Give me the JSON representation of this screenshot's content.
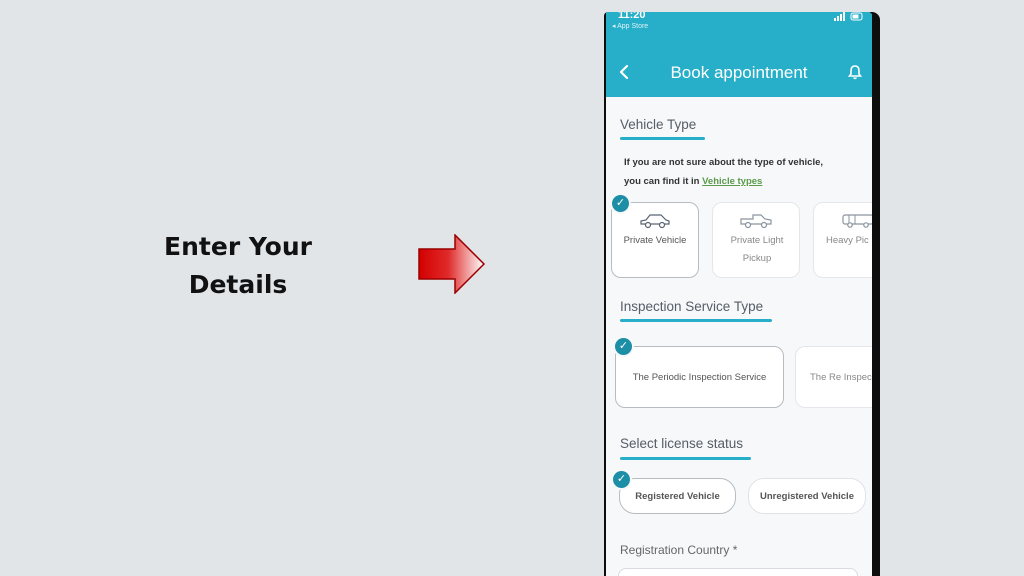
{
  "caption": {
    "line1": "Enter Your",
    "line2": "Details"
  },
  "colors": {
    "accent": "#27aec8",
    "check": "#1c8ea6",
    "arrow": "#d40000",
    "link": "#5a9a4a"
  },
  "status_bar": {
    "time": "11:20",
    "back_to": "◂ App Store",
    "icons": "📶 ◔ ▭"
  },
  "header": {
    "title": "Book appointment",
    "back_icon": "chevron-left-icon",
    "bell_icon": "bell-icon"
  },
  "vehicle_type": {
    "title": "Vehicle Type",
    "hint_line1": "If you are not sure about the type of vehicle,",
    "hint_line2": "you can find it in",
    "hint_link": "Vehicle types",
    "options": [
      {
        "label": "Private Vehicle",
        "selected": true
      },
      {
        "label": "Private Light Pickup",
        "selected": false
      },
      {
        "label": "Heavy Pic",
        "selected": false
      }
    ]
  },
  "inspection_service": {
    "title": "Inspection Service Type",
    "options": [
      {
        "label": "The Periodic Inspection Service",
        "selected": true
      },
      {
        "label": "The Re Inspec",
        "selected": false
      }
    ]
  },
  "license_status": {
    "title": "Select license status",
    "options": [
      {
        "label": "Registered Vehicle",
        "selected": true
      },
      {
        "label": "Unregistered Vehicle",
        "selected": false
      }
    ]
  },
  "registration_country": {
    "label": "Registration Country *"
  }
}
